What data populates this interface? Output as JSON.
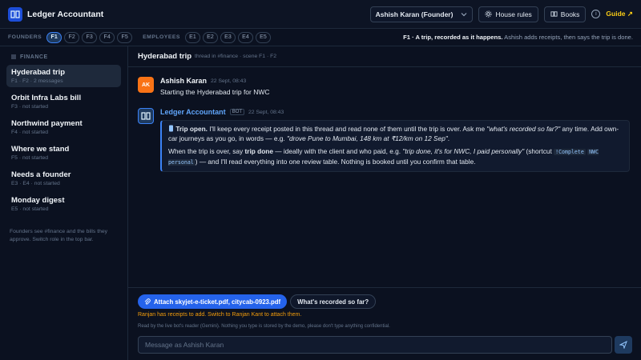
{
  "app": {
    "title": "Ledger Accountant"
  },
  "topbar": {
    "user_select": "Ashish Karan (Founder)",
    "house_rules": "House rules",
    "books": "Books",
    "guide": "Guide ↗"
  },
  "rolebar": {
    "founders_label": "FOUNDERS",
    "founders": [
      "F1",
      "F2",
      "F3",
      "F4",
      "F5"
    ],
    "employees_label": "EMPLOYEES",
    "employees": [
      "E1",
      "E2",
      "E3",
      "E4",
      "E5"
    ],
    "desc_bold": "F1 · A trip, recorded as it happens.",
    "desc_rest": " Ashish adds receipts, then says the trip is done."
  },
  "sidebar": {
    "section": "FINANCE",
    "items": [
      {
        "title": "Hyderabad trip",
        "meta": "F1 · F2 · 2 messages"
      },
      {
        "title": "Orbit Infra Labs bill",
        "meta": "F3 · not started"
      },
      {
        "title": "Northwind payment",
        "meta": "F4 · not started"
      },
      {
        "title": "Where we stand",
        "meta": "F5 · not started"
      },
      {
        "title": "Needs a founder",
        "meta": "E3 · E4 · not started"
      },
      {
        "title": "Monday digest",
        "meta": "E5 · not started"
      }
    ],
    "note": "Founders see #finance and the bills they approve. Switch role in the top bar."
  },
  "thread": {
    "title": "Hyderabad trip",
    "sub": "thread in #finance · scene F1 · F2"
  },
  "messages": {
    "user": {
      "initials": "AK",
      "name": "Ashish Karan",
      "time": "22 Sept, 08:43",
      "text": "Starting the Hyderabad trip for NWC"
    },
    "bot": {
      "name": "Ledger Accountant",
      "badge": "BOT",
      "time": "22 Sept, 08:43",
      "p1_bold": "Trip open.",
      "p1_a": " I'll keep every receipt posted in this thread and read none of them until the trip is over. Ask me ",
      "p1_i1": "\"what's recorded so far?\"",
      "p1_b": " any time. Add own-car journeys as you go, in words — e.g. ",
      "p1_i2": "\"drove Pune to Mumbai, 148 km at ₹12/km on 12 Sep\"",
      "p1_c": ".",
      "p2_a": "When the trip is over, say ",
      "p2_bold": "trip done",
      "p2_b": " — ideally with the client and who paid, e.g. ",
      "p2_i": "\"trip done, it's for NWC, I paid personally\"",
      "p2_c": " (shortcut ",
      "p2_code1": "!Complete",
      "p2_code2": "NWC personal",
      "p2_d": ") — and I'll read everything into one review table. Nothing is booked until you confirm that table."
    }
  },
  "composer": {
    "attach": "Attach skyjet-e-ticket.pdf, citycab-0923.pdf",
    "recorded": "What's recorded so far?",
    "warning": "Ranjan has receipts to add. Switch to Ranjan Kant to attach them.",
    "disclaimer": "Read by the live bot's reader (Gemini). Nothing you type is stored by the demo, please don't type anything confidential.",
    "placeholder": "Message as Ashish Karan"
  },
  "colors": {
    "accent": "#2563eb",
    "warning": "#f59e0b",
    "guide": "#facc15",
    "avatar_user": "#f97316"
  },
  "icons": [
    "book-logo-icon",
    "chevron-down-icon",
    "gear-icon",
    "book-icon",
    "info-icon",
    "stack-icon",
    "clip-icon",
    "send-icon"
  ]
}
